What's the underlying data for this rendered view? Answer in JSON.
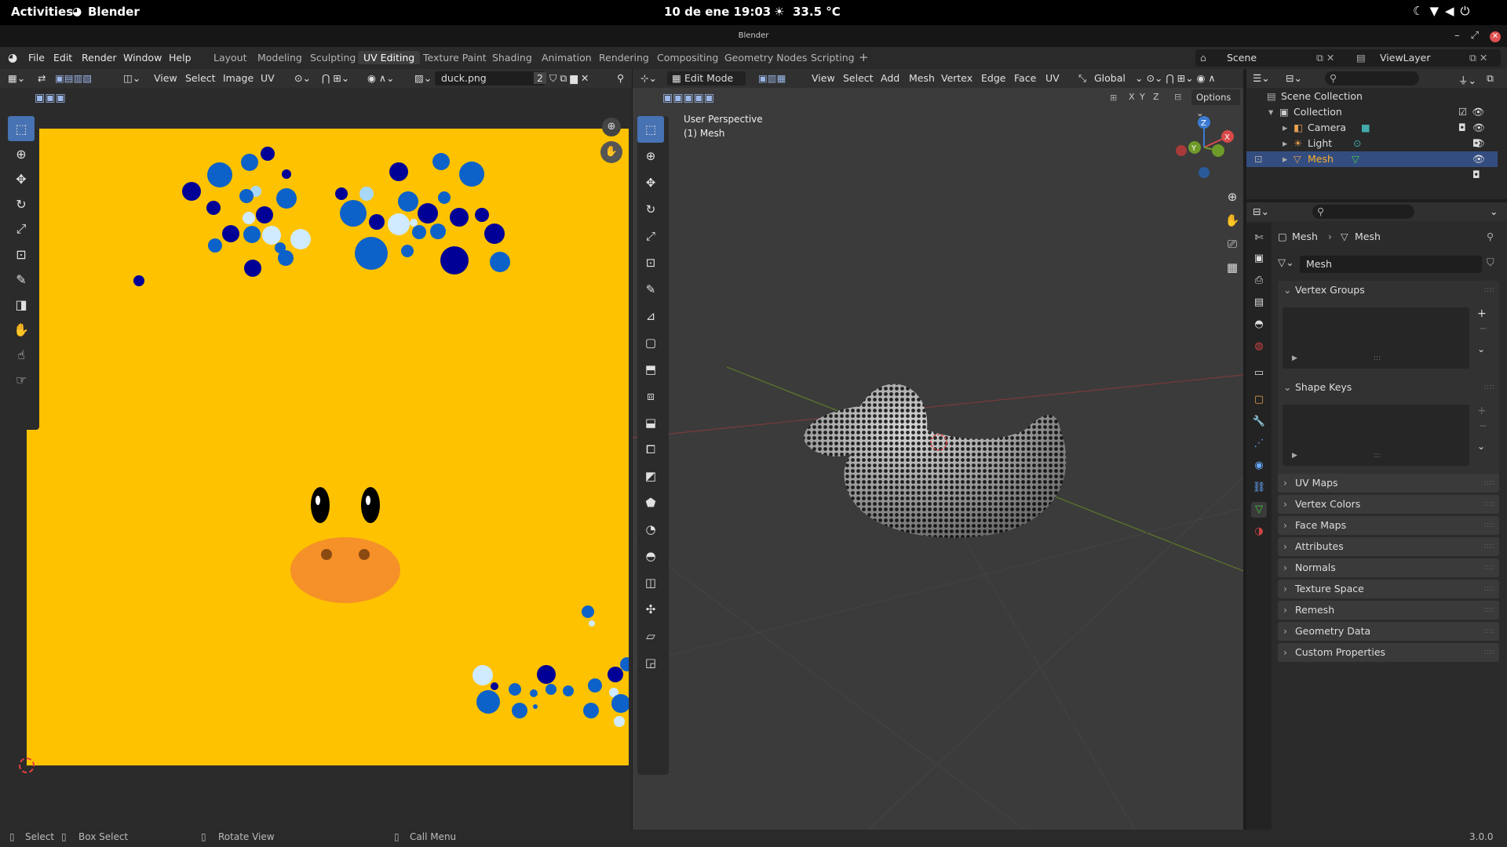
{
  "gnome": {
    "activities": "Activities",
    "app": "Blender",
    "clock": "10 de ene  19:03",
    "weather": "33.5 °C"
  },
  "window": {
    "title": "Blender"
  },
  "menu": {
    "file": "File",
    "edit": "Edit",
    "render": "Render",
    "window": "Window",
    "help": "Help"
  },
  "workspaces": [
    "Layout",
    "Modeling",
    "Sculpting",
    "UV Editing",
    "Texture Paint",
    "Shading",
    "Animation",
    "Rendering",
    "Compositing",
    "Geometry Nodes",
    "Scripting"
  ],
  "scene": {
    "label": "Scene",
    "viewlayer": "ViewLayer"
  },
  "uv_editor": {
    "view": "View",
    "select": "Select",
    "image": "Image",
    "uv": "UV",
    "image_name": "duck.png",
    "users": "2"
  },
  "viewport": {
    "mode": "Edit Mode",
    "view": "View",
    "select": "Select",
    "add": "Add",
    "mesh": "Mesh",
    "vertex": "Vertex",
    "edge": "Edge",
    "face": "Face",
    "uv": "UV",
    "orientation": "Global",
    "overlay_title": "User Perspective",
    "overlay_sub": "(1) Mesh",
    "options": "Options",
    "x": "X",
    "y": "Y",
    "z": "Z"
  },
  "outliner": {
    "scene_collection": "Scene Collection",
    "collection": "Collection",
    "camera": "Camera",
    "light": "Light",
    "mesh": "Mesh"
  },
  "properties": {
    "crumb1": "Mesh",
    "crumb2": "Mesh",
    "datablock": "Mesh",
    "vertex_groups": "Vertex Groups",
    "shape_keys": "Shape Keys",
    "panels": [
      "UV Maps",
      "Vertex Colors",
      "Face Maps",
      "Attributes",
      "Normals",
      "Texture Space",
      "Remesh",
      "Geometry Data",
      "Custom Properties"
    ]
  },
  "statusbar": {
    "select": "Select",
    "box_select": "Box Select",
    "rotate": "Rotate View",
    "call_menu": "Call Menu",
    "version": "3.0.0"
  },
  "colors": {
    "texture_bg": "#ffc200",
    "accent": "#4772b3",
    "selected_row": "#334d80"
  }
}
